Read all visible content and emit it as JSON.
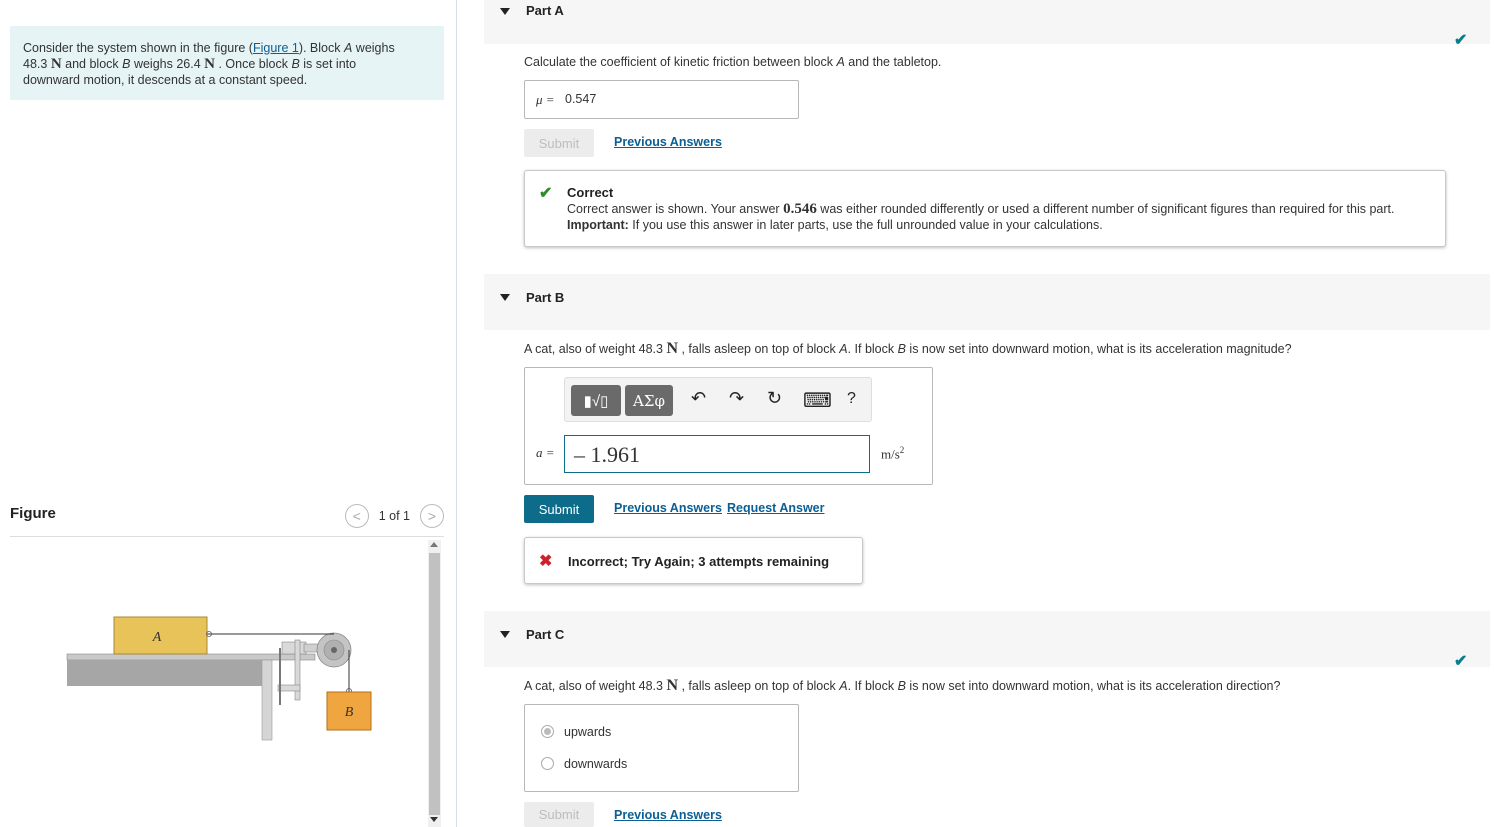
{
  "problem": {
    "prefix": "Consider the system shown in the figure (",
    "figure_link": "Figure 1",
    "after_link": "). Block ",
    "block_a": "A",
    "weighs": " weighs",
    "weight_a": "48.3",
    "unit_n": "N",
    "and_block": " and block ",
    "block_b": "B",
    "weighs2": " weighs ",
    "weight_b": "26.4",
    "once_block": " . Once block ",
    "is_set": " is set into",
    "line3": "downward motion, it descends at a constant speed."
  },
  "figure": {
    "title": "Figure",
    "pager_text": "1 of 1",
    "prev_glyph": "<",
    "next_glyph": ">",
    "label_a": "A",
    "label_b": "B"
  },
  "part_a": {
    "label": "Part A",
    "question_prefix": "Calculate the coefficient of kinetic friction between block ",
    "question_var": "A",
    "question_suffix": " and the tabletop.",
    "mu_label": "μ =",
    "mu_value": "0.547",
    "submit": "Submit",
    "previous_answers": "Previous Answers",
    "feedback_title": "Correct",
    "feedback_line1_prefix": "Correct answer is shown. Your answer ",
    "feedback_answer": "0.546",
    "feedback_line1_suffix": " was either rounded differently or used a different number of significant figures than required for this part.",
    "important_label": "Important:",
    "important_text": " If you use this answer in later parts, use the full unrounded value in your calculations."
  },
  "part_b": {
    "label": "Part B",
    "q_prefix": "A cat, also of weight 48.3 ",
    "q_unit": "N",
    "q_mid": " , falls asleep on top of block ",
    "q_var_a": "A",
    "q_mid2": ". If block ",
    "q_var_b": "B",
    "q_suffix": " is now set into downward motion, what is its acceleration magnitude?",
    "toolbar": {
      "templates_glyph": "▮√▯",
      "symbols_glyph": "ΑΣφ",
      "undo_glyph": "↶",
      "redo_glyph": "↷",
      "reset_glyph": "↻",
      "keyboard_glyph": "⌨",
      "help_glyph": "?"
    },
    "a_label": "a =",
    "a_value": "– 1.961",
    "unit": "m/s",
    "unit_exp": "2",
    "submit": "Submit",
    "previous_answers": "Previous Answers",
    "request_answer": "Request Answer",
    "feedback_icon": "✖",
    "feedback_text": "Incorrect; Try Again; 3 attempts remaining"
  },
  "part_c": {
    "label": "Part C",
    "q_prefix": "A cat, also of weight 48.3 ",
    "q_unit": "N",
    "q_mid": " , falls asleep on top of block ",
    "q_var_a": "A",
    "q_mid2": ". If block ",
    "q_var_b": "B",
    "q_suffix": " is now set into downward motion, what is its acceleration direction?",
    "options": [
      "upwards",
      "downwards"
    ],
    "selected_option": "upwards",
    "submit": "Submit",
    "previous_answers": "Previous Answers"
  },
  "colors": {
    "accent": "#0d6c8a",
    "correct_green": "#2e8b2e",
    "incorrect_red": "#d1202a",
    "block_a_fill": "#e8c35a",
    "block_b_fill": "#f0a640",
    "problem_bg": "#e6f4f5"
  },
  "icons": {
    "part_toggle": "triangle-down-icon",
    "correct_mark": "checkmark-icon"
  }
}
